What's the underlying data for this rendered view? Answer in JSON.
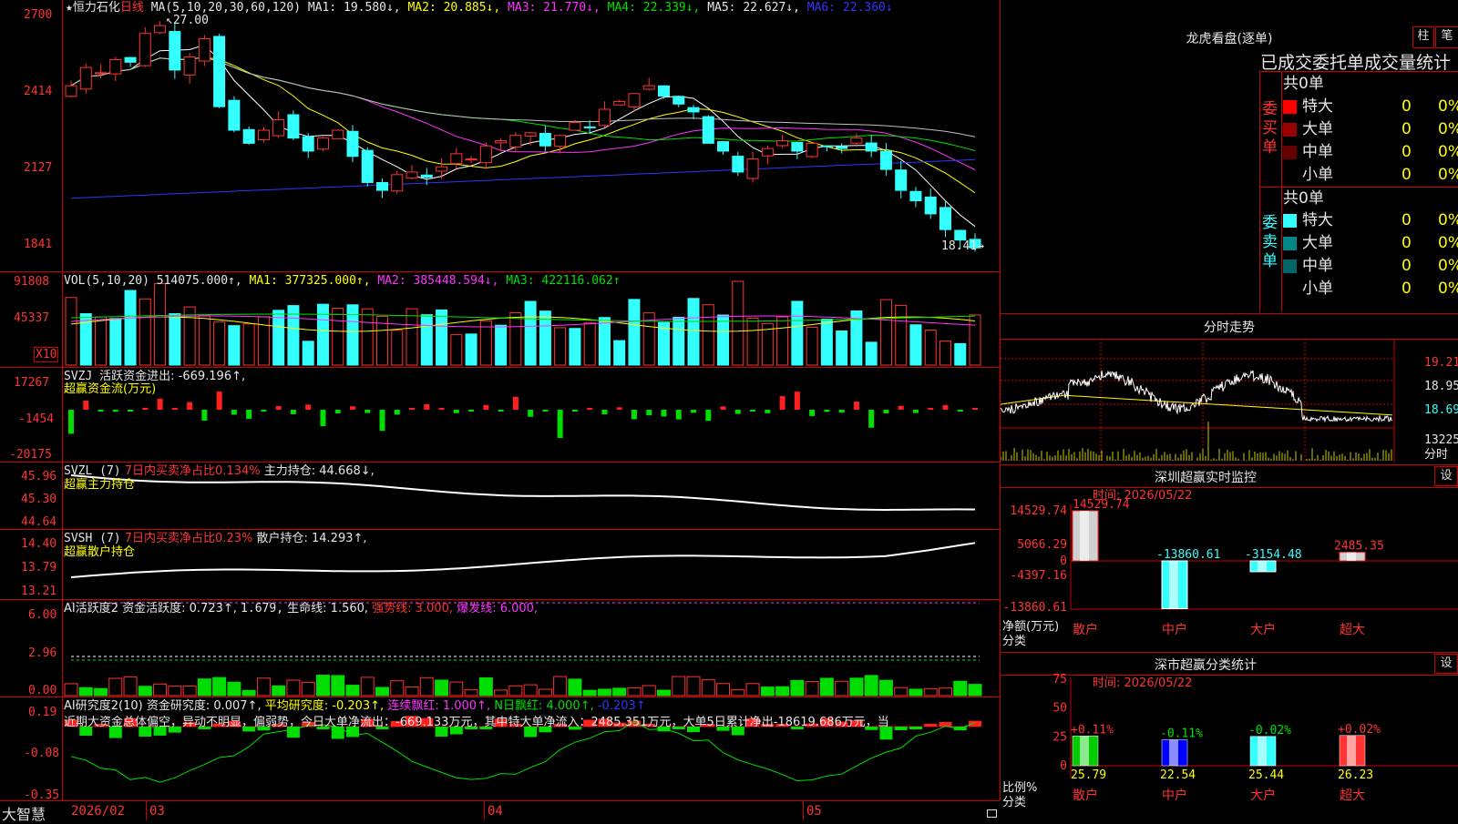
{
  "stock": {
    "star": "★",
    "name": "恒力石化",
    "period": "日线"
  },
  "main_chart": {
    "ma_params": "MA(5,10,20,30,60,120)",
    "ma1": "MA1: 19.580↓,",
    "ma2": "MA2: 20.885↓,",
    "ma3": "MA3: 21.770↓,",
    "ma4": "MA4: 22.339↓,",
    "ma5": "MA5: 22.627↓,",
    "ma6": "MA6: 22.360↓",
    "high_label": "27.00",
    "low_label": "18.41",
    "y_ticks": [
      "2700",
      "2414",
      "2127",
      "1841"
    ],
    "colors": {
      "up": "#ff3333",
      "down": "#33ffff",
      "ma1": "#ffffff",
      "ma2": "#ffff00",
      "ma3": "#ff33ff",
      "ma4": "#00e000",
      "ma5": "#c0c0c0",
      "ma6": "#3333ff"
    }
  },
  "vol_panel": {
    "title": "VOL(5,10,20)",
    "value": "514075.000↑,",
    "ma1": "MA1: 377325.000↑,",
    "ma2": "MA2: 385448.594↓,",
    "ma3": "MA3: 422116.062↑",
    "y_ticks": [
      "91808",
      "45337"
    ],
    "unit": "X10"
  },
  "svzj_panel": {
    "title": "SVZJ",
    "label": "活跃资金进出: -669.196↑,",
    "subtitle": "超赢资金流(万元)",
    "y_ticks": [
      "17267",
      "-1454",
      "-20175"
    ]
  },
  "svzl_panel": {
    "title": "SVZL (7)",
    "label1": "7日内买卖净占比0.134%",
    "label2": "主力持仓: 44.668↓,",
    "subtitle": "超赢主力持仓",
    "y_ticks": [
      "45.96",
      "45.30",
      "44.64"
    ]
  },
  "svsh_panel": {
    "title": "SVSH (7)",
    "label1": "7日内买卖净占比0.23%",
    "label2": "散户持仓: 14.293↑,",
    "subtitle": "超赢散户持仓",
    "y_ticks": [
      "14.40",
      "13.79",
      "13.21"
    ]
  },
  "ai_active_panel": {
    "title": "AI活跃度2",
    "label": "资金活跃度: 0.723↑,",
    "v2": "1.679,",
    "life": "生命线: 1.560,",
    "strong": "强势线: 3.000,",
    "burst": "爆发线: 6.000,",
    "y_ticks": [
      "6.00",
      "2.96",
      "0.00"
    ]
  },
  "ai_research_panel": {
    "title": "AI研究度2(10)",
    "label": "资金研究度: 0.007↑,",
    "avg": "平均研究度: -0.203↑,",
    "streak": "连续飘红: 1.000↑,",
    "nday": "N日飘红: 4.000↑,",
    "last": "-0.203↑",
    "summary": "近期大资金总体偏空，异动不明显，偏弱势，今日大单净流出：-669.133万元，其中特大单净流入：2485.351万元，大单5日累计净出-18619.686万元，当",
    "y_ticks": [
      "0.19",
      "-0.08",
      "-0.35"
    ]
  },
  "x_axis": {
    "brand": "大智慧",
    "labels": [
      "2026/02",
      "03",
      "04",
      "05"
    ]
  },
  "right": {
    "dragon_title": "龙虎看盘(逐单)",
    "btn_zhu": "柱",
    "btn_bi": "笔",
    "stats_title": "已成交委托单成交量统计",
    "buy_side": {
      "side_label": "委买单",
      "count": "共0单",
      "rows": [
        {
          "label": "特大",
          "vol": "0",
          "pct": "0%",
          "color": "#ff0000"
        },
        {
          "label": "大单",
          "vol": "0",
          "pct": "0%",
          "color": "#990000"
        },
        {
          "label": "中单",
          "vol": "0",
          "pct": "0%",
          "color": "#660000"
        },
        {
          "label": "小单",
          "vol": "0",
          "pct": "0%",
          "color": "#000000"
        }
      ]
    },
    "sell_side": {
      "side_label": "委卖单",
      "count": "共0单",
      "rows": [
        {
          "label": "特大",
          "vol": "0",
          "pct": "0%",
          "color": "#33ffff"
        },
        {
          "label": "大单",
          "vol": "0",
          "pct": "0%",
          "color": "#008888"
        },
        {
          "label": "中单",
          "vol": "0",
          "pct": "0%",
          "color": "#006666"
        },
        {
          "label": "小单",
          "vol": "0",
          "pct": "0%",
          "color": "#000000"
        }
      ]
    },
    "intraday": {
      "title": "分时走势",
      "prices": [
        "19.21",
        "18.95",
        "18.69"
      ],
      "volume": "13225",
      "vol_label": "分时"
    },
    "sz_monitor": {
      "title": "深圳超赢实时监控",
      "btn": "设",
      "time": "时间: 2026/05/22",
      "y_ticks": [
        "14529.74",
        "5066.29",
        "0",
        "-4397.16",
        "-13860.61"
      ],
      "unit": "净额(万元)",
      "cat_label": "分类",
      "bars": [
        {
          "cat": "散户",
          "value": 14529.74,
          "label": "14529.74"
        },
        {
          "cat": "中户",
          "value": -13860.61,
          "label": "-13860.61"
        },
        {
          "cat": "大户",
          "value": -3154.48,
          "label": "-3154.48"
        },
        {
          "cat": "超大",
          "value": 2485.35,
          "label": "2485.35"
        }
      ]
    },
    "sz_category": {
      "title": "深市超赢分类统计",
      "btn": "设",
      "time": "时间: 2026/05/22",
      "y_ticks": [
        "75",
        "50",
        "25",
        "0"
      ],
      "unit": "比例%",
      "cat_label": "分类",
      "bars": [
        {
          "cat": "散户",
          "value": 25.79,
          "change": "+0.11%",
          "label": "25.79",
          "color": "#00cc00"
        },
        {
          "cat": "中户",
          "value": 22.54,
          "change": "-0.11%",
          "label": "22.54",
          "color": "#0000ff"
        },
        {
          "cat": "大户",
          "value": 25.44,
          "change": "-0.02%",
          "label": "25.44",
          "color": "#33ffff"
        },
        {
          "cat": "超大",
          "value": 26.23,
          "change": "+0.02%",
          "label": "26.23",
          "color": "#ff3333"
        }
      ]
    }
  }
}
